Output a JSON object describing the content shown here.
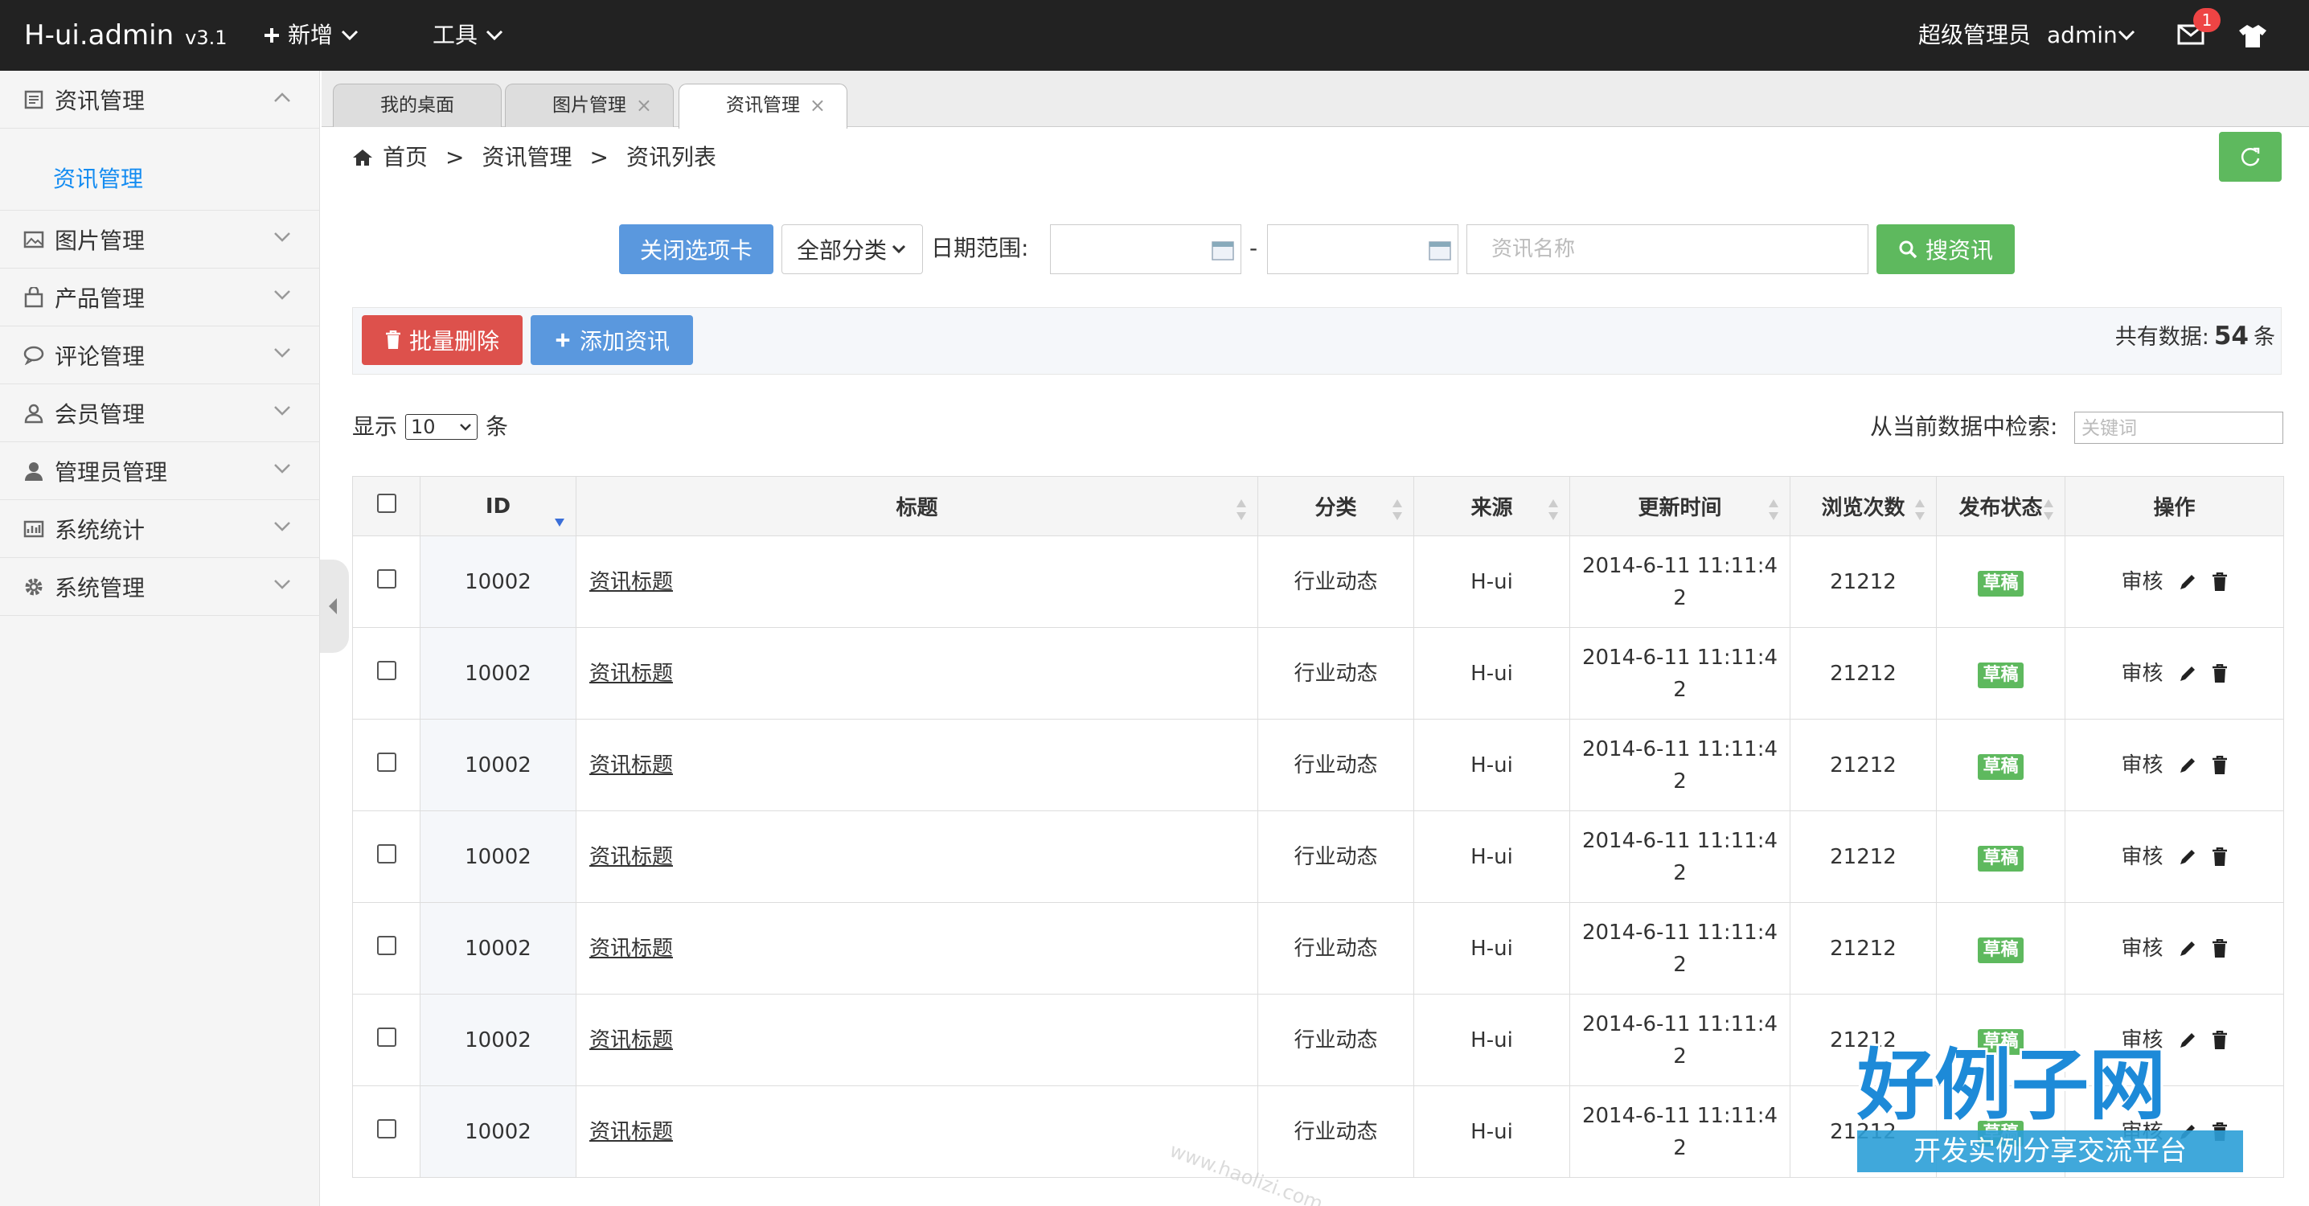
{
  "brand": {
    "name": "H-ui.admin",
    "version": "v3.1"
  },
  "topnav": {
    "add": "新增",
    "tools": "工具"
  },
  "user": {
    "role": "超级管理员",
    "name": "admin",
    "msg_count": "1"
  },
  "sidebar": {
    "items": [
      {
        "label": "资讯管理",
        "icon": "news-icon"
      },
      {
        "label": "图片管理",
        "icon": "picture-icon"
      },
      {
        "label": "产品管理",
        "icon": "bag-icon"
      },
      {
        "label": "评论管理",
        "icon": "comment-icon"
      },
      {
        "label": "会员管理",
        "icon": "user-icon"
      },
      {
        "label": "管理员管理",
        "icon": "admin-icon"
      },
      {
        "label": "系统统计",
        "icon": "stats-icon"
      },
      {
        "label": "系统管理",
        "icon": "gear-icon"
      }
    ],
    "subitem": "资讯管理"
  },
  "tabs": [
    {
      "label": "我的桌面"
    },
    {
      "label": "图片管理"
    },
    {
      "label": "资讯管理"
    }
  ],
  "tab_close": "×",
  "breadcrumb": {
    "home": "首页",
    "sep": ">",
    "level1": "资讯管理",
    "level2": "资讯列表"
  },
  "search": {
    "close_tabs": "关闭选项卡",
    "category": "全部分类",
    "date_label": "日期范围:",
    "dash": "-",
    "name_placeholder": "资讯名称",
    "search_btn": "搜资讯"
  },
  "actions": {
    "batch_delete": "批量删除",
    "add_news": "添加资讯",
    "total_label": "共有数据:",
    "total": "54",
    "total_unit": "条"
  },
  "pager": {
    "show": "显示",
    "size": "10",
    "unit": "条",
    "filter_label": "从当前数据中检索:",
    "filter_placeholder": "关键词"
  },
  "table": {
    "headers": {
      "id": "ID",
      "title": "标题",
      "category": "分类",
      "source": "来源",
      "updated": "更新时间",
      "views": "浏览次数",
      "status": "发布状态",
      "ops": "操作"
    },
    "rows": [
      {
        "id": "10002",
        "title": "资讯标题",
        "category": "行业动态",
        "source": "H-ui",
        "updated": "2014-6-11 11:11:42",
        "views": "21212",
        "status": "草稿",
        "op": "审核"
      },
      {
        "id": "10002",
        "title": "资讯标题",
        "category": "行业动态",
        "source": "H-ui",
        "updated": "2014-6-11 11:11:42",
        "views": "21212",
        "status": "草稿",
        "op": "审核"
      },
      {
        "id": "10002",
        "title": "资讯标题",
        "category": "行业动态",
        "source": "H-ui",
        "updated": "2014-6-11 11:11:42",
        "views": "21212",
        "status": "草稿",
        "op": "审核"
      },
      {
        "id": "10002",
        "title": "资讯标题",
        "category": "行业动态",
        "source": "H-ui",
        "updated": "2014-6-11 11:11:42",
        "views": "21212",
        "status": "草稿",
        "op": "审核"
      },
      {
        "id": "10002",
        "title": "资讯标题",
        "category": "行业动态",
        "source": "H-ui",
        "updated": "2014-6-11 11:11:42",
        "views": "21212",
        "status": "草稿",
        "op": "审核"
      },
      {
        "id": "10002",
        "title": "资讯标题",
        "category": "行业动态",
        "source": "H-ui",
        "updated": "2014-6-11 11:11:42",
        "views": "21212",
        "status": "草稿",
        "op": "审核"
      },
      {
        "id": "10002",
        "title": "资讯标题",
        "category": "行业动态",
        "source": "H-ui",
        "updated": "2014-6-11 11:11:42",
        "views": "21212",
        "status": "草稿",
        "op": "审核"
      }
    ]
  },
  "watermark": {
    "site": "www.haolizi.com",
    "big": "好例子网",
    "small": "开发实例分享交流平台"
  },
  "colors": {
    "topbar": "#222222",
    "primary": "#5a98de",
    "success": "#5eb95e",
    "danger": "#dd514c",
    "link": "#148cf1"
  }
}
